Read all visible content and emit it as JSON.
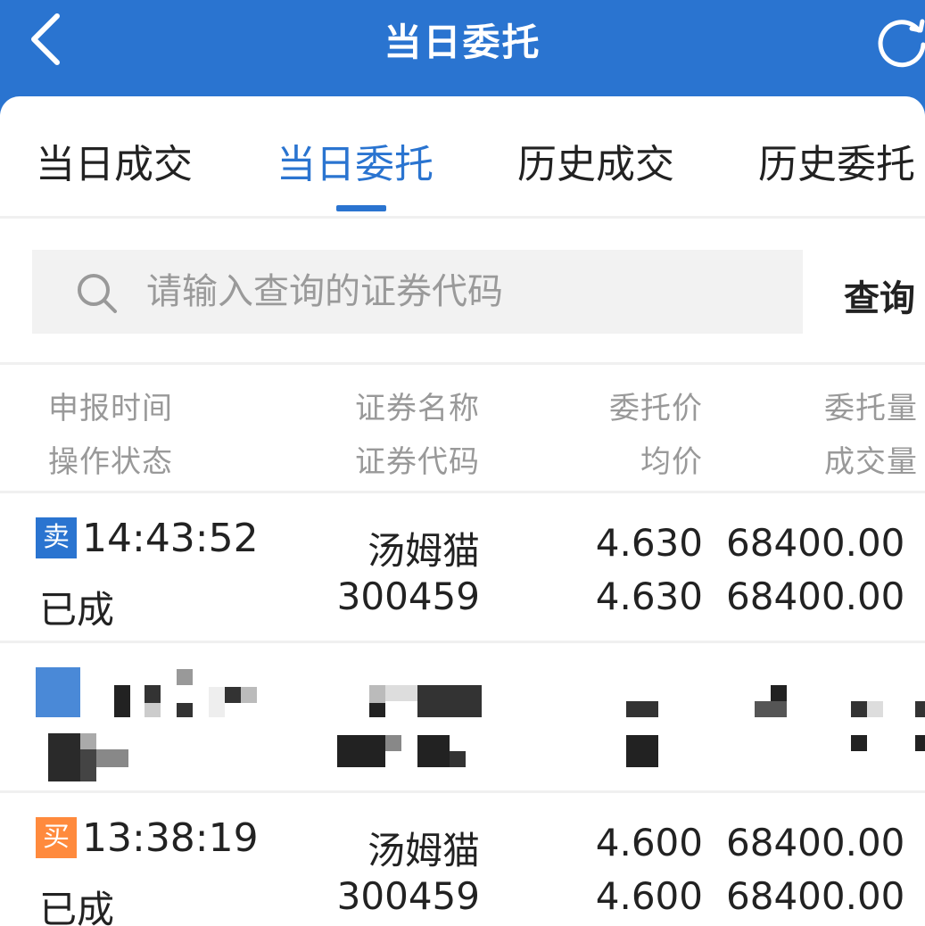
{
  "header": {
    "title": "当日委托",
    "back_icon": "chevron-left-icon",
    "refresh_icon": "refresh-icon"
  },
  "tabs": [
    {
      "label": "当日成交"
    },
    {
      "label": "当日委托"
    },
    {
      "label": "历史成交"
    },
    {
      "label": "历史委托"
    }
  ],
  "active_tab": 1,
  "search": {
    "placeholder": "请输入查询的证券代码",
    "value": "",
    "button_label": "查询"
  },
  "columns": {
    "col1": [
      "申报时间",
      "操作状态"
    ],
    "col2": [
      "证券名称",
      "证券代码"
    ],
    "col3": [
      "委托价",
      "均价"
    ],
    "col4": [
      "委托量",
      "成交量"
    ]
  },
  "rows": [
    {
      "side": "卖",
      "time": "14:43:52",
      "status": "已成",
      "name": "汤姆猫",
      "code": "300459",
      "price": "4.630",
      "avg_price": "4.630",
      "order_qty": "68400.00",
      "filled_qty": "68400.00"
    },
    {
      "redacted": true
    },
    {
      "side": "买",
      "time": "13:38:19",
      "status": "已成",
      "name": "汤姆猫",
      "code": "300459",
      "price": "4.600",
      "avg_price": "4.600",
      "order_qty": "68400.00",
      "filled_qty": "68400.00"
    }
  ],
  "colors": {
    "primary": "#2a74d0",
    "sell_badge": "#2a74d0",
    "buy_badge": "#ff8a3d"
  }
}
